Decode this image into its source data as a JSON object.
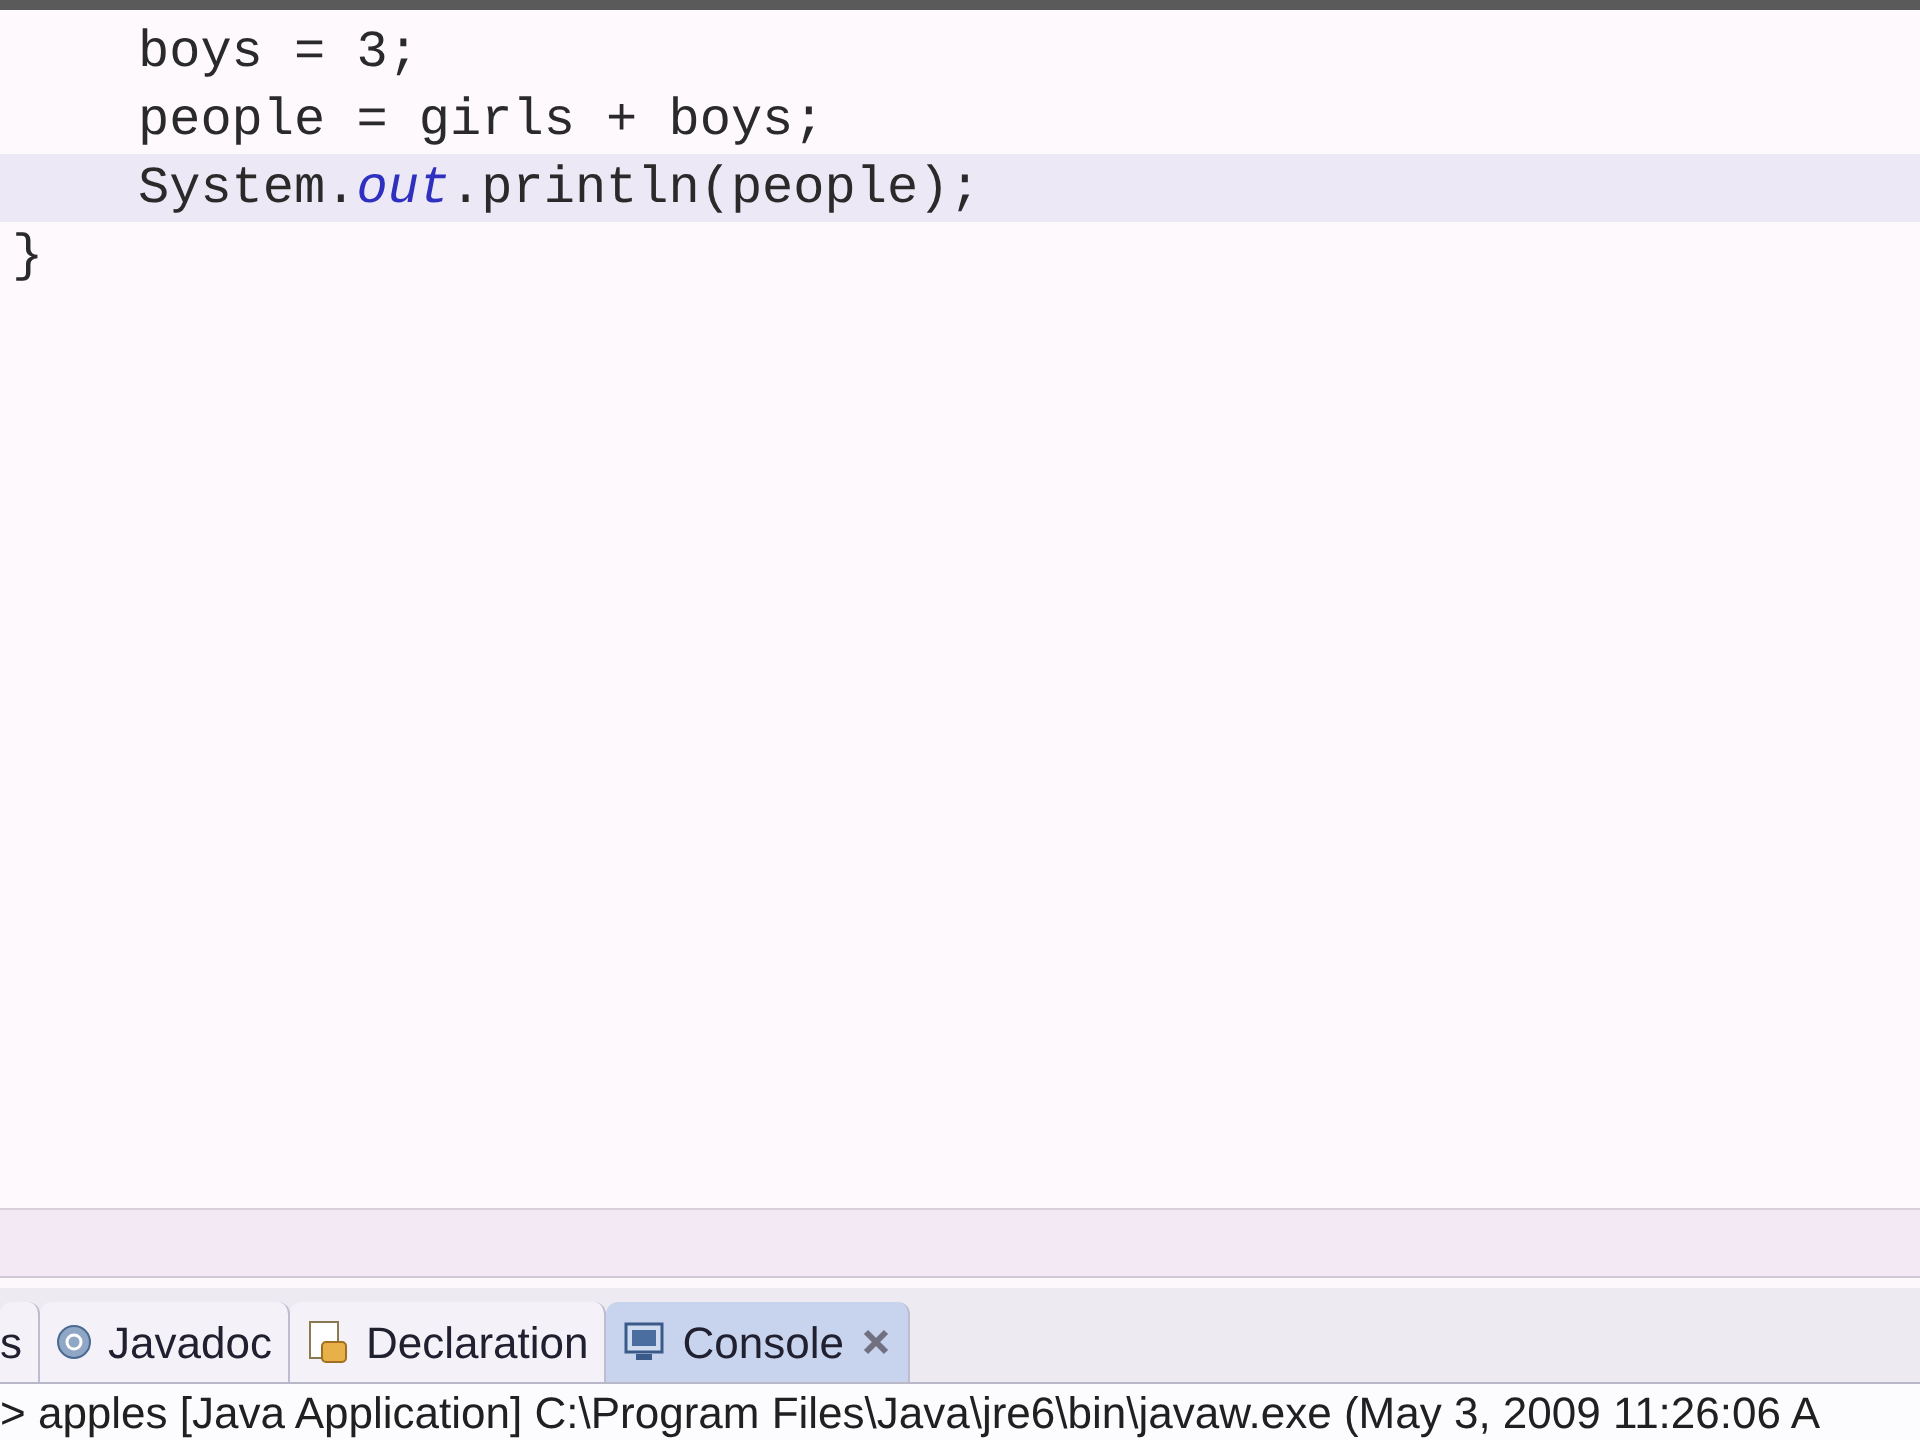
{
  "editor": {
    "lines": [
      {
        "indent": true,
        "current": false,
        "tokens": [
          {
            "kind": "plain",
            "text": "boys = 3;"
          }
        ]
      },
      {
        "indent": true,
        "current": false,
        "tokens": [
          {
            "kind": "plain",
            "text": "people = girls + boys;"
          }
        ]
      },
      {
        "indent": true,
        "current": true,
        "tokens": [
          {
            "kind": "plain",
            "text": "System."
          },
          {
            "kind": "field",
            "text": "out"
          },
          {
            "kind": "plain",
            "text": ".println(people);"
          }
        ]
      },
      {
        "indent": false,
        "current": false,
        "tokens": [
          {
            "kind": "plain",
            "text": "}"
          }
        ]
      }
    ]
  },
  "panel_tabs": [
    {
      "label": "s",
      "selected": false
    },
    {
      "label": "Javadoc",
      "selected": false
    },
    {
      "label": "Declaration",
      "selected": false
    },
    {
      "label": "Console",
      "selected": true
    }
  ],
  "console": {
    "status": "> apples [Java Application] C:\\Program Files\\Java\\jre6\\bin\\javaw.exe (May 3, 2009 11:26:06 A"
  }
}
